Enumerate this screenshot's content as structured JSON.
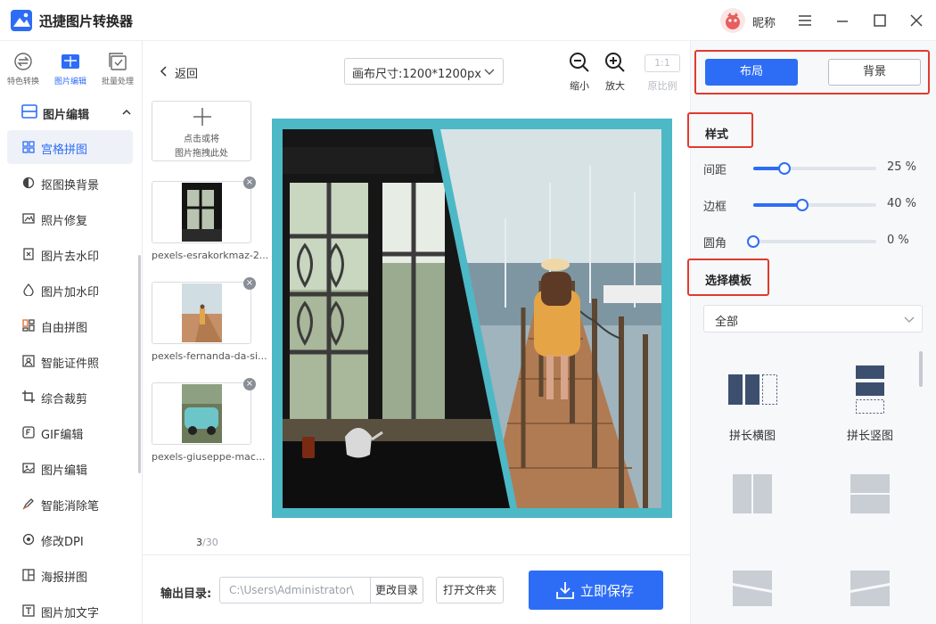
{
  "app": {
    "title": "迅捷图片转换器",
    "user_name": "昵称"
  },
  "modes": [
    {
      "label": "特色转换",
      "icon": "convert-icon"
    },
    {
      "label": "图片编辑",
      "icon": "image-edit-icon"
    },
    {
      "label": "批量处理",
      "icon": "batch-icon"
    }
  ],
  "sidebar": {
    "group_label": "图片编辑",
    "items": [
      {
        "label": "宫格拼图",
        "icon": "grid-icon"
      },
      {
        "label": "抠图换背景",
        "icon": "cutout-icon"
      },
      {
        "label": "照片修复",
        "icon": "photo-repair-icon"
      },
      {
        "label": "图片去水印",
        "icon": "remove-watermark-icon"
      },
      {
        "label": "图片加水印",
        "icon": "add-watermark-icon"
      },
      {
        "label": "自由拼图",
        "icon": "free-collage-icon"
      },
      {
        "label": "智能证件照",
        "icon": "id-photo-icon"
      },
      {
        "label": "综合裁剪",
        "icon": "crop-icon"
      },
      {
        "label": "GIF编辑",
        "icon": "gif-icon"
      },
      {
        "label": "图片编辑",
        "icon": "image-icon"
      },
      {
        "label": "智能消除笔",
        "icon": "eraser-pen-icon"
      },
      {
        "label": "修改DPI",
        "icon": "dpi-icon"
      },
      {
        "label": "海报拼图",
        "icon": "poster-icon"
      },
      {
        "label": "图片加文字",
        "icon": "text-icon"
      }
    ]
  },
  "toolbar": {
    "back_label": "返回",
    "canvas_size": "画布尺寸:1200*1200px",
    "zoom_out": "缩小",
    "zoom_in": "放大",
    "ratio_box": "1:1",
    "ratio_label": "原比例"
  },
  "upload": {
    "line1": "点击或将",
    "line2": "图片拖拽此处"
  },
  "thumbnails": [
    {
      "name": "pexels-esrakorkmaz-2..."
    },
    {
      "name": "pexels-fernanda-da-si..."
    },
    {
      "name": "pexels-giuseppe-mac..."
    }
  ],
  "pagination": {
    "current": "3",
    "total": "/30"
  },
  "output": {
    "label": "输出目录:",
    "path": "C:\\Users\\Administrator\\",
    "change_dir": "更改目录",
    "open_folder": "打开文件夹",
    "save": "立即保存"
  },
  "panel": {
    "tab_layout": "布局",
    "tab_background": "背景",
    "style_title": "样式",
    "sliders": [
      {
        "label": "间距",
        "value": 25,
        "text": "25  %"
      },
      {
        "label": "边框",
        "value": 40,
        "text": "40  %"
      },
      {
        "label": "圆角",
        "value": 0,
        "text": "0  %"
      }
    ],
    "template_title": "选择模板",
    "filter_value": "全部",
    "templates": [
      {
        "name": "拼长横图"
      },
      {
        "name": "拼长竖图"
      }
    ]
  },
  "colors": {
    "accent": "#2d6df6",
    "highlight": "#e03a2f",
    "canvas_border": "#4db8c6"
  }
}
